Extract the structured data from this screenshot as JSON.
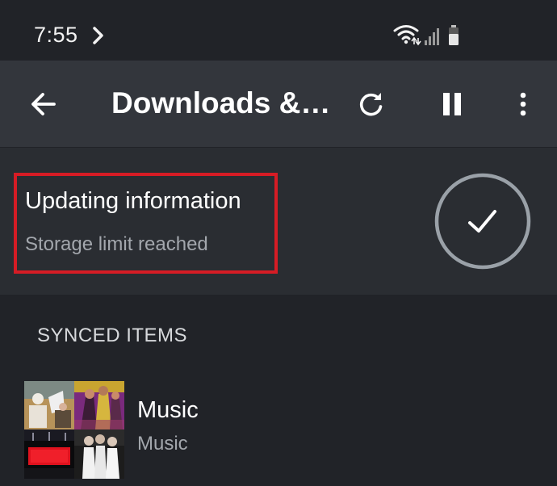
{
  "status_bar": {
    "time": "7:55",
    "icons": [
      "wifi-icon",
      "signal-icon",
      "battery-icon"
    ]
  },
  "toolbar": {
    "title": "Downloads &…",
    "back_icon": "arrow-back-icon",
    "refresh_icon": "refresh-icon",
    "pause_icon": "pause-icon",
    "more_icon": "more-vert-icon"
  },
  "sync_status": {
    "title": "Updating information",
    "subtitle": "Storage limit reached",
    "icon": "check-circle-icon"
  },
  "section": {
    "header": "SYNCED ITEMS"
  },
  "synced_items": [
    {
      "title": "Music",
      "subtitle": "Music",
      "icon": "album-collage"
    }
  ],
  "colors": {
    "background": "#212328",
    "toolbar": "#33363c",
    "card": "#2a2d32",
    "highlight": "#d61c25",
    "secondary_text": "#a3a7ad"
  }
}
